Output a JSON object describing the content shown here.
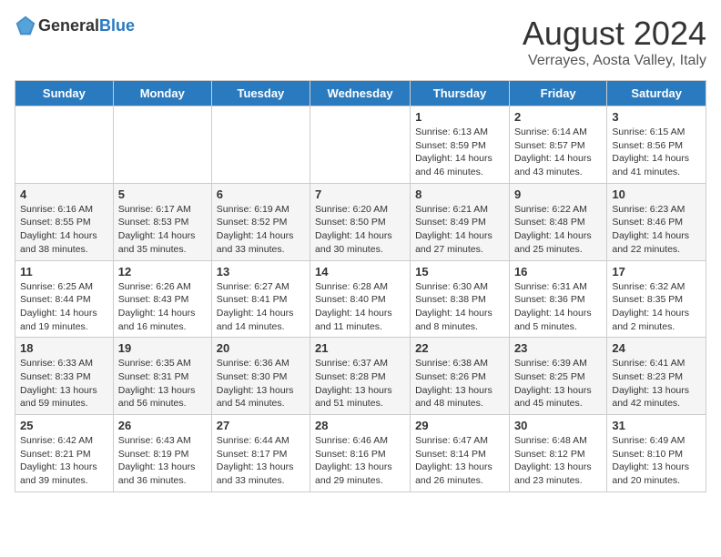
{
  "header": {
    "logo_general": "General",
    "logo_blue": "Blue",
    "month": "August 2024",
    "location": "Verrayes, Aosta Valley, Italy"
  },
  "days_of_week": [
    "Sunday",
    "Monday",
    "Tuesday",
    "Wednesday",
    "Thursday",
    "Friday",
    "Saturday"
  ],
  "weeks": [
    [
      {
        "day": "",
        "info": ""
      },
      {
        "day": "",
        "info": ""
      },
      {
        "day": "",
        "info": ""
      },
      {
        "day": "",
        "info": ""
      },
      {
        "day": "1",
        "info": "Sunrise: 6:13 AM\nSunset: 8:59 PM\nDaylight: 14 hours and 46 minutes."
      },
      {
        "day": "2",
        "info": "Sunrise: 6:14 AM\nSunset: 8:57 PM\nDaylight: 14 hours and 43 minutes."
      },
      {
        "day": "3",
        "info": "Sunrise: 6:15 AM\nSunset: 8:56 PM\nDaylight: 14 hours and 41 minutes."
      }
    ],
    [
      {
        "day": "4",
        "info": "Sunrise: 6:16 AM\nSunset: 8:55 PM\nDaylight: 14 hours and 38 minutes."
      },
      {
        "day": "5",
        "info": "Sunrise: 6:17 AM\nSunset: 8:53 PM\nDaylight: 14 hours and 35 minutes."
      },
      {
        "day": "6",
        "info": "Sunrise: 6:19 AM\nSunset: 8:52 PM\nDaylight: 14 hours and 33 minutes."
      },
      {
        "day": "7",
        "info": "Sunrise: 6:20 AM\nSunset: 8:50 PM\nDaylight: 14 hours and 30 minutes."
      },
      {
        "day": "8",
        "info": "Sunrise: 6:21 AM\nSunset: 8:49 PM\nDaylight: 14 hours and 27 minutes."
      },
      {
        "day": "9",
        "info": "Sunrise: 6:22 AM\nSunset: 8:48 PM\nDaylight: 14 hours and 25 minutes."
      },
      {
        "day": "10",
        "info": "Sunrise: 6:23 AM\nSunset: 8:46 PM\nDaylight: 14 hours and 22 minutes."
      }
    ],
    [
      {
        "day": "11",
        "info": "Sunrise: 6:25 AM\nSunset: 8:44 PM\nDaylight: 14 hours and 19 minutes."
      },
      {
        "day": "12",
        "info": "Sunrise: 6:26 AM\nSunset: 8:43 PM\nDaylight: 14 hours and 16 minutes."
      },
      {
        "day": "13",
        "info": "Sunrise: 6:27 AM\nSunset: 8:41 PM\nDaylight: 14 hours and 14 minutes."
      },
      {
        "day": "14",
        "info": "Sunrise: 6:28 AM\nSunset: 8:40 PM\nDaylight: 14 hours and 11 minutes."
      },
      {
        "day": "15",
        "info": "Sunrise: 6:30 AM\nSunset: 8:38 PM\nDaylight: 14 hours and 8 minutes."
      },
      {
        "day": "16",
        "info": "Sunrise: 6:31 AM\nSunset: 8:36 PM\nDaylight: 14 hours and 5 minutes."
      },
      {
        "day": "17",
        "info": "Sunrise: 6:32 AM\nSunset: 8:35 PM\nDaylight: 14 hours and 2 minutes."
      }
    ],
    [
      {
        "day": "18",
        "info": "Sunrise: 6:33 AM\nSunset: 8:33 PM\nDaylight: 13 hours and 59 minutes."
      },
      {
        "day": "19",
        "info": "Sunrise: 6:35 AM\nSunset: 8:31 PM\nDaylight: 13 hours and 56 minutes."
      },
      {
        "day": "20",
        "info": "Sunrise: 6:36 AM\nSunset: 8:30 PM\nDaylight: 13 hours and 54 minutes."
      },
      {
        "day": "21",
        "info": "Sunrise: 6:37 AM\nSunset: 8:28 PM\nDaylight: 13 hours and 51 minutes."
      },
      {
        "day": "22",
        "info": "Sunrise: 6:38 AM\nSunset: 8:26 PM\nDaylight: 13 hours and 48 minutes."
      },
      {
        "day": "23",
        "info": "Sunrise: 6:39 AM\nSunset: 8:25 PM\nDaylight: 13 hours and 45 minutes."
      },
      {
        "day": "24",
        "info": "Sunrise: 6:41 AM\nSunset: 8:23 PM\nDaylight: 13 hours and 42 minutes."
      }
    ],
    [
      {
        "day": "25",
        "info": "Sunrise: 6:42 AM\nSunset: 8:21 PM\nDaylight: 13 hours and 39 minutes."
      },
      {
        "day": "26",
        "info": "Sunrise: 6:43 AM\nSunset: 8:19 PM\nDaylight: 13 hours and 36 minutes."
      },
      {
        "day": "27",
        "info": "Sunrise: 6:44 AM\nSunset: 8:17 PM\nDaylight: 13 hours and 33 minutes."
      },
      {
        "day": "28",
        "info": "Sunrise: 6:46 AM\nSunset: 8:16 PM\nDaylight: 13 hours and 29 minutes."
      },
      {
        "day": "29",
        "info": "Sunrise: 6:47 AM\nSunset: 8:14 PM\nDaylight: 13 hours and 26 minutes."
      },
      {
        "day": "30",
        "info": "Sunrise: 6:48 AM\nSunset: 8:12 PM\nDaylight: 13 hours and 23 minutes."
      },
      {
        "day": "31",
        "info": "Sunrise: 6:49 AM\nSunset: 8:10 PM\nDaylight: 13 hours and 20 minutes."
      }
    ]
  ]
}
